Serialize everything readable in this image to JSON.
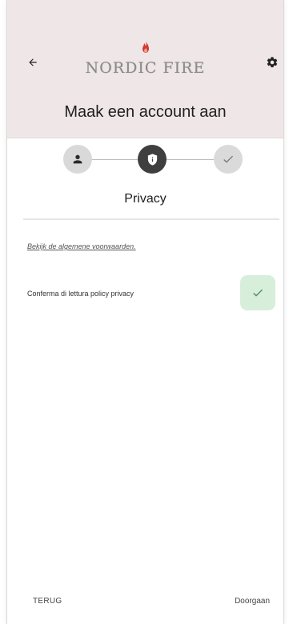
{
  "header": {
    "logo_text": "NORDIC FIRE",
    "title": "Maak een account aan",
    "background_color": "#efe6e8"
  },
  "stepper": {
    "steps": [
      {
        "icon": "person-icon",
        "state": "completed"
      },
      {
        "icon": "shield-icon",
        "state": "active"
      },
      {
        "icon": "check-icon",
        "state": "upcoming"
      }
    ],
    "active_title": "Privacy",
    "active_color": "#3f3f3f",
    "inactive_color": "#d9d9d9"
  },
  "content": {
    "terms_link": "Bekijk de algemene voorwaarden.",
    "privacy_label": "Conferma di lettura policy privacy",
    "privacy_checked": true,
    "check_color": "#d7eedb"
  },
  "footer": {
    "back_label": "TERUG",
    "next_label": "Doorgaan"
  }
}
